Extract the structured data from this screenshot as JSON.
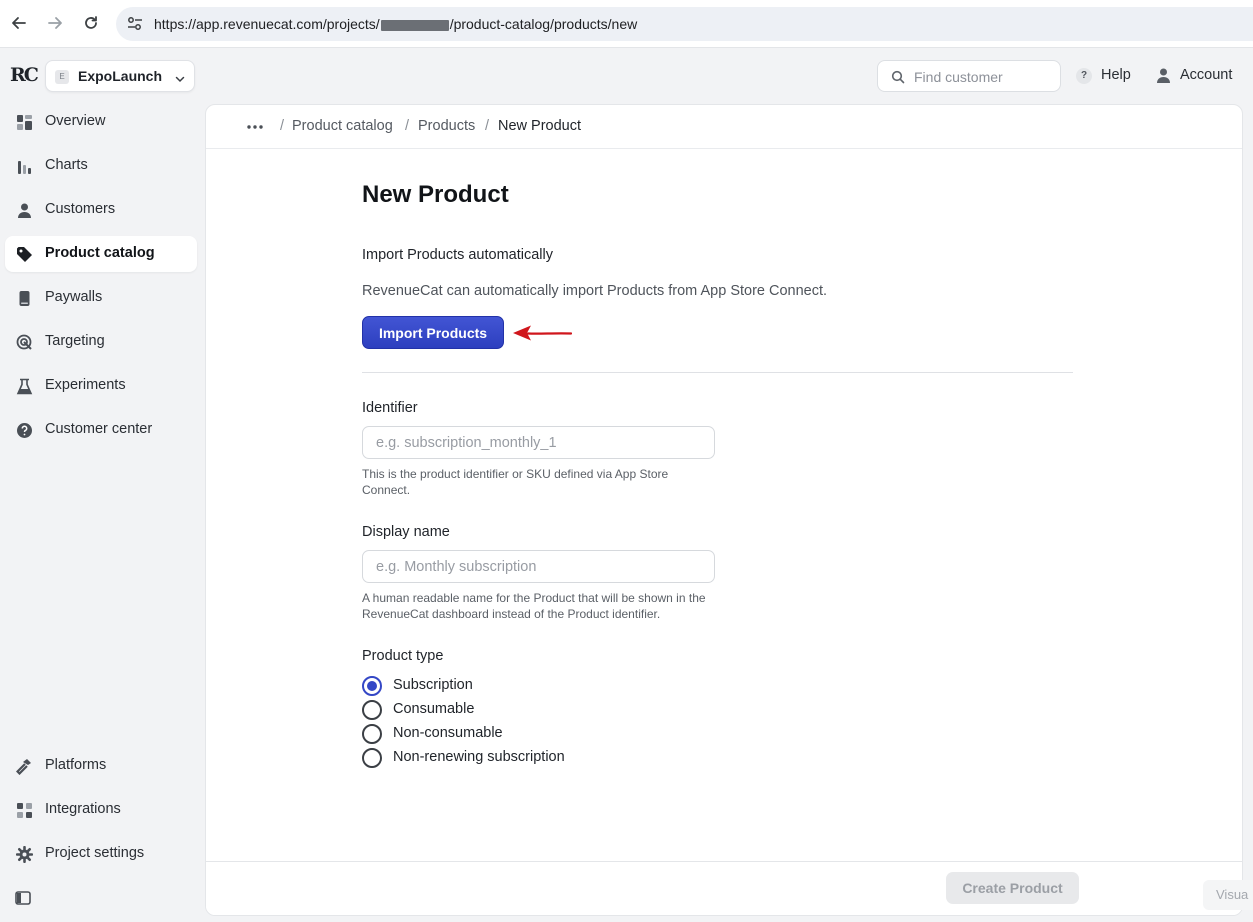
{
  "browser": {
    "url_prefix": "https://app.revenuecat.com/projects/",
    "url_suffix": "/product-catalog/products/new"
  },
  "logo": {
    "text": "RC"
  },
  "project": {
    "badge": "E",
    "name": "ExpoLaunch"
  },
  "sidebar": {
    "items": [
      {
        "label": "Overview",
        "icon": "grid-icon"
      },
      {
        "label": "Charts",
        "icon": "bar-chart-icon"
      },
      {
        "label": "Customers",
        "icon": "person-icon"
      },
      {
        "label": "Product catalog",
        "icon": "tag-icon",
        "active": true
      },
      {
        "label": "Paywalls",
        "icon": "phone-icon"
      },
      {
        "label": "Targeting",
        "icon": "target-icon"
      },
      {
        "label": "Experiments",
        "icon": "flask-icon"
      },
      {
        "label": "Customer center",
        "icon": "question-icon"
      }
    ],
    "bottom_items": [
      {
        "label": "Platforms",
        "icon": "hammer-icon"
      },
      {
        "label": "Integrations",
        "icon": "integrations-icon"
      },
      {
        "label": "Project settings",
        "icon": "gear-icon"
      }
    ]
  },
  "header": {
    "search_placeholder": "Find customer",
    "help_label": "Help",
    "help_icon_text": "?",
    "account_label": "Account"
  },
  "breadcrumb": {
    "items": [
      "Product catalog",
      "Products",
      "New Product"
    ],
    "separator": "/"
  },
  "form": {
    "title": "New Product",
    "import_heading": "Import Products automatically",
    "import_description": "RevenueCat can automatically import Products from App Store Connect.",
    "import_button": "Import Products",
    "identifier": {
      "label": "Identifier",
      "placeholder": "e.g. subscription_monthly_1",
      "value": "",
      "help": "This is the product identifier or SKU defined via App Store Connect."
    },
    "display_name": {
      "label": "Display name",
      "placeholder": "e.g. Monthly subscription",
      "value": "",
      "help": "A human readable name for the Product that will be shown in the RevenueCat dashboard instead of the Product identifier."
    },
    "product_type": {
      "label": "Product type",
      "options": [
        "Subscription",
        "Consumable",
        "Non-consumable",
        "Non-renewing subscription"
      ],
      "selected": "Subscription"
    },
    "create_button": "Create Product"
  },
  "overlay": {
    "visual_chip": "Visua"
  },
  "colors": {
    "accent": "#3447c6",
    "arrow": "#d0161c",
    "sidebar_bg": "#f2f3f5"
  }
}
